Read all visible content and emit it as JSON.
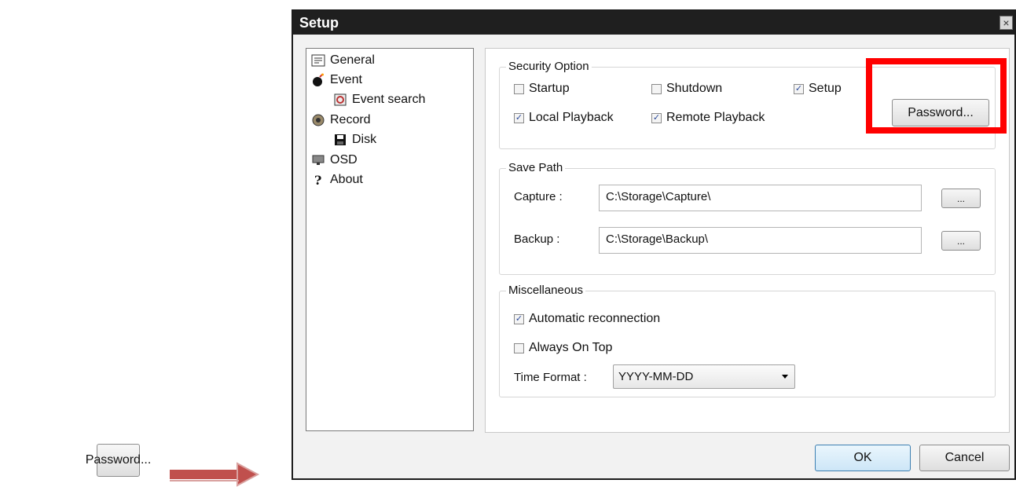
{
  "callout": {
    "button_label": "Password..."
  },
  "dialog": {
    "title": "Setup",
    "close_symbol": "×",
    "nav": [
      {
        "label": "General",
        "icon": "general-icon"
      },
      {
        "label": "Event",
        "icon": "event-icon"
      },
      {
        "label": "Event search",
        "icon": "event-search-icon"
      },
      {
        "label": "Record",
        "icon": "record-icon"
      },
      {
        "label": "Disk",
        "icon": "disk-icon"
      },
      {
        "label": "OSD",
        "icon": "osd-icon"
      },
      {
        "label": "About",
        "icon": "about-icon"
      }
    ],
    "security": {
      "title": "Security Option",
      "options": [
        {
          "label": "Startup",
          "checked": false
        },
        {
          "label": "Shutdown",
          "checked": false
        },
        {
          "label": "Setup",
          "checked": true
        },
        {
          "label": "Local Playback",
          "checked": true
        },
        {
          "label": "Remote Playback",
          "checked": true
        }
      ],
      "password_button": "Password..."
    },
    "save_path": {
      "title": "Save Path",
      "capture_label": "Capture :",
      "capture_value": "C:\\Storage\\Capture\\",
      "backup_label": "Backup :",
      "backup_value": "C:\\Storage\\Backup\\",
      "browse_label": "..."
    },
    "misc": {
      "title": "Miscellaneous",
      "auto_reconnect": {
        "label": "Automatic reconnection",
        "checked": true
      },
      "always_on_top": {
        "label": "Always On Top",
        "checked": false
      },
      "time_format_label": "Time Format :",
      "time_format_value": "YYYY-MM-DD"
    },
    "ok_label": "OK",
    "cancel_label": "Cancel"
  },
  "colors": {
    "highlight": "#ff0000",
    "titlebar": "#1f1f1f",
    "arrow": "#c0504d"
  }
}
